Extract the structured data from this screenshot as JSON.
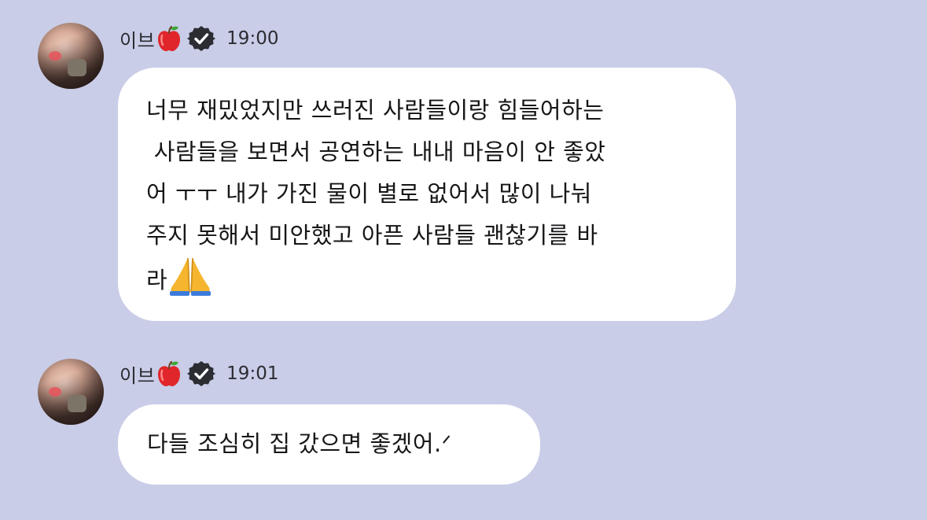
{
  "colors": {
    "background": "#c9cde7",
    "bubble": "#ffffff",
    "text": "#161618",
    "verified_badge": "#2c2d33",
    "apple": "#e0262b"
  },
  "messages": [
    {
      "sender": "이브",
      "sender_icons": [
        "red-apple-icon",
        "verified-badge-icon"
      ],
      "time": "19:00",
      "lines": [
        "너무 재밌었지만 쓰러진 사람들이랑 힘들어하는",
        " 사람들을 보면서 공연하는 내내 마음이 안 좋았",
        "어 ㅜㅜ 내가 가진 물이 별로 없어서 많이 나눠",
        "주지 못해서 미안했고 아픈 사람들 괜찮기를 바"
      ],
      "last_line": "라",
      "last_line_emoji": "folded-hands-icon"
    },
    {
      "sender": "이브",
      "sender_icons": [
        "red-apple-icon",
        "verified-badge-icon"
      ],
      "time": "19:01",
      "lines": [
        "다들 조심히 집 갔으면 좋겠어.ᐟ"
      ]
    }
  ]
}
